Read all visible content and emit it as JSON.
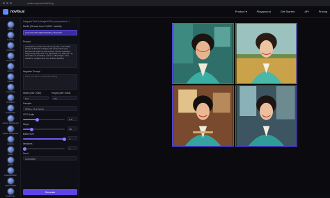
{
  "browser": {
    "url": "novita.ai/product/txt2img"
  },
  "brand": {
    "name": "novita.ai"
  },
  "nav": {
    "product": "Product ▾",
    "playground": "Playground",
    "get_started": "Get Started",
    "api": "API",
    "pricing": "Pricing"
  },
  "sidebar": {
    "items": [
      {
        "label": "txt2img",
        "icon": "txt2img-icon"
      },
      {
        "label": "img2img",
        "icon": "img2img-icon"
      },
      {
        "label": "inpainting",
        "icon": "inpainting-icon"
      },
      {
        "label": "merge face",
        "icon": "merge-face-icon"
      },
      {
        "label": "cleanup",
        "icon": "cleanup-icon"
      },
      {
        "label": "upscale",
        "icon": "upscale-icon"
      },
      {
        "label": "outpainting",
        "icon": "outpainting-icon"
      },
      {
        "label": "controlnet",
        "icon": "controlnet-icon"
      },
      {
        "label": "img2prompt",
        "icon": "img2prompt-icon"
      },
      {
        "label": "remove background",
        "icon": "remove-bg-icon"
      },
      {
        "label": "replace background",
        "icon": "replace-bg-icon"
      },
      {
        "label": "mixpose",
        "icon": "mixpose-icon"
      },
      {
        "label": "inpaint",
        "icon": "inpaint-icon"
      },
      {
        "label": "doodle",
        "icon": "doodle-icon"
      },
      {
        "label": "superresolution",
        "icon": "superresolution-icon"
      },
      {
        "label": "replace object",
        "icon": "replace-object-icon"
      },
      {
        "label": "replace sky",
        "icon": "replace-sky-icon"
      }
    ]
  },
  "panel": {
    "intro": "Integrate Text to Image API to your product >>",
    "model_label": "Model (Choose from 10,000+ models)",
    "model_value": "protovisionXLHighFidelity3D_release06...",
    "prompt_label": "Prompt",
    "prompt_value": "(masterpiece, portrait, 1woman ((1.2)), 30s, in the 1940s, dressed in Burnette Cardigan with varsity stripes polo, Burnette hair styled up, Bonnet back, luscious eyelashes, designed by Vivien Carr 1.2), (MAGNUS 1.2), ADD ITS 1.2), Cinematic 1.3, Illustration, Autumn, diffused light, warm ambiance, vintage mood, cozy ambient detailed)",
    "negative_label": "Negative Prompt",
    "negative_placeholder": "What you want to avoid generating",
    "width_label": "Width (256~2048)",
    "width_value": "512",
    "height_label": "Height (256~2048)",
    "height_value": "512",
    "sampler_label": "Sampler",
    "sampler_value": "DPM++ 2S a Karras",
    "cfg_label": "CFG Scale",
    "cfg_value": "6.5",
    "steps_label": "Steps",
    "steps_value": "20",
    "batch_label": "Batch Size",
    "batch_value": "4",
    "iterations_label": "Iterations",
    "iterations_value": "1",
    "seed_label": "Seed",
    "seed_value": "136516838",
    "generate_label": "Generate"
  }
}
